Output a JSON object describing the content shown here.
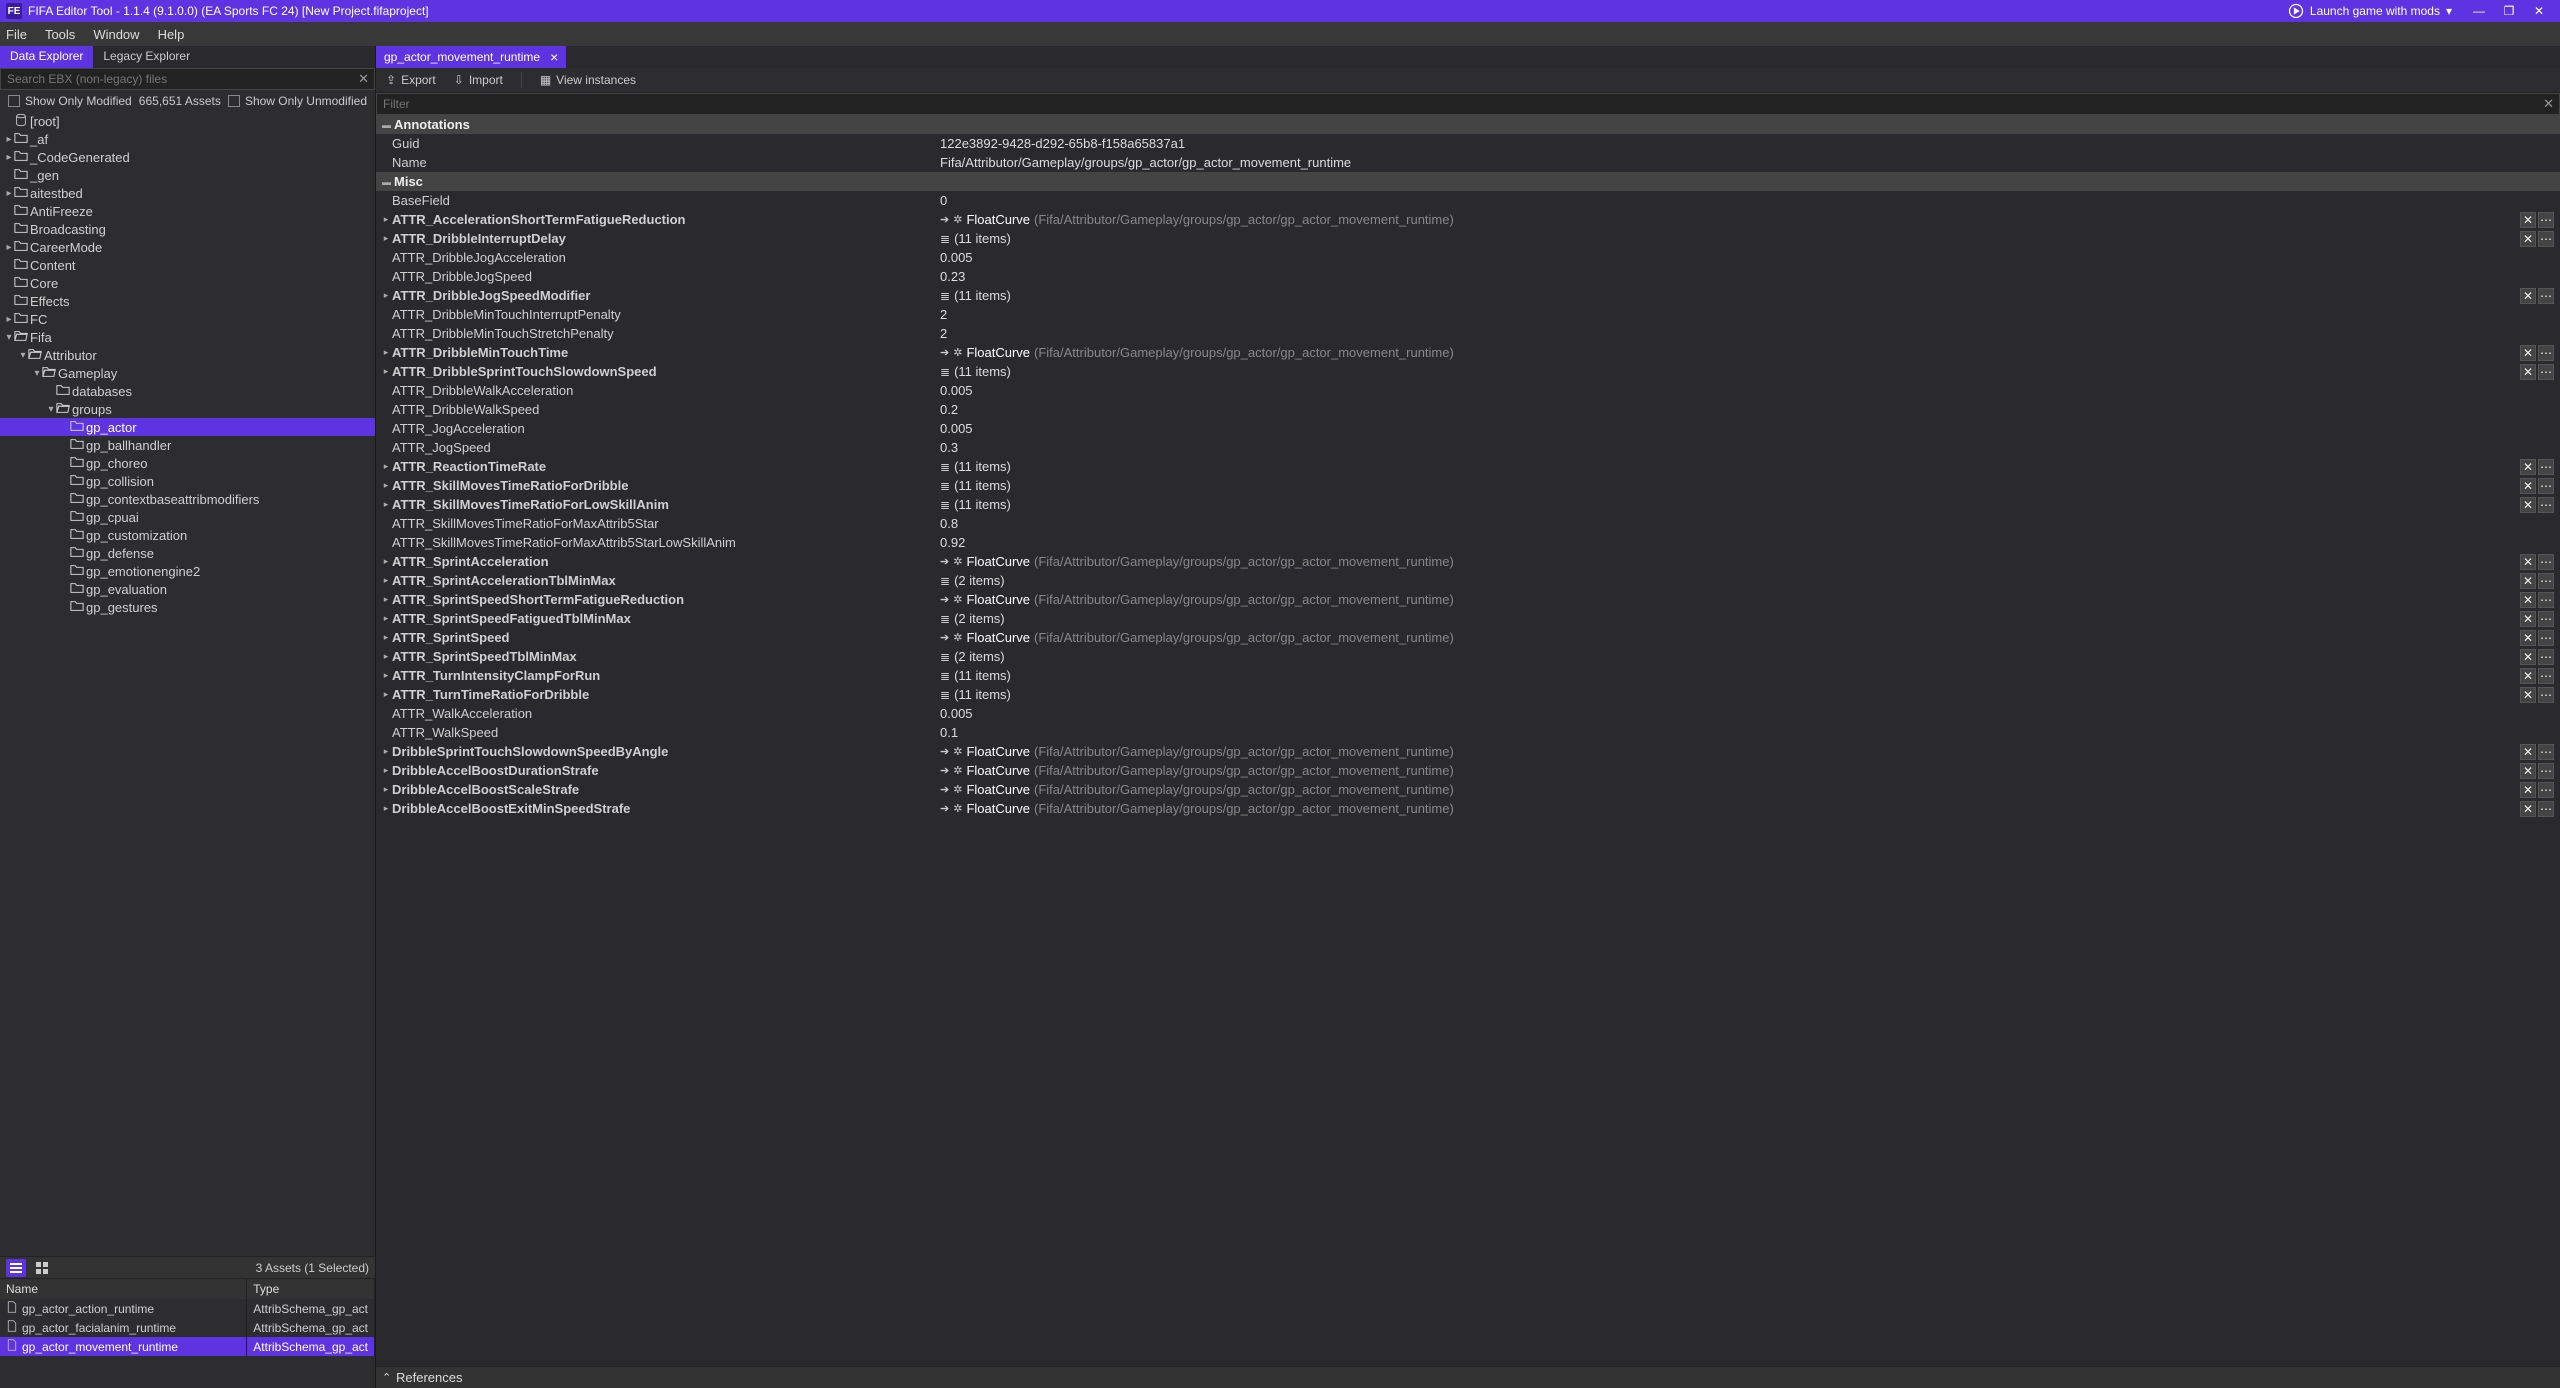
{
  "window": {
    "title": "FIFA Editor Tool - 1.1.4 (9.1.0.0) (EA Sports FC 24) [New Project.fifaproject]",
    "launch": "Launch game with mods"
  },
  "menu": [
    "File",
    "Tools",
    "Window",
    "Help"
  ],
  "left": {
    "tabs": [
      "Data Explorer",
      "Legacy Explorer"
    ],
    "search_ph": "Search EBX (non-legacy) files",
    "show_modified": "Show Only Modified",
    "asset_count": "665,651 Assets",
    "show_unmodified": "Show Only Unmodified",
    "tree": [
      {
        "d": 0,
        "ic": "db",
        "t": "[root]",
        "c": 0
      },
      {
        "d": 0,
        "ic": "f",
        "t": "_af",
        "c": 1
      },
      {
        "d": 0,
        "ic": "f",
        "t": "_CodeGenerated",
        "c": 1
      },
      {
        "d": 0,
        "ic": "f",
        "t": "_gen",
        "c": 0
      },
      {
        "d": 0,
        "ic": "f",
        "t": "aitestbed",
        "c": 1
      },
      {
        "d": 0,
        "ic": "f",
        "t": "AntiFreeze",
        "c": 0
      },
      {
        "d": 0,
        "ic": "f",
        "t": "Broadcasting",
        "c": 0
      },
      {
        "d": 0,
        "ic": "f",
        "t": "CareerMode",
        "c": 1
      },
      {
        "d": 0,
        "ic": "f",
        "t": "Content",
        "c": 0
      },
      {
        "d": 0,
        "ic": "f",
        "t": "Core",
        "c": 0
      },
      {
        "d": 0,
        "ic": "f",
        "t": "Effects",
        "c": 0
      },
      {
        "d": 0,
        "ic": "f",
        "t": "FC",
        "c": 1
      },
      {
        "d": 0,
        "ic": "fo",
        "t": "Fifa",
        "c": 2
      },
      {
        "d": 1,
        "ic": "fo",
        "t": "Attributor",
        "c": 2
      },
      {
        "d": 2,
        "ic": "fo",
        "t": "Gameplay",
        "c": 2
      },
      {
        "d": 3,
        "ic": "f",
        "t": "databases",
        "c": 0
      },
      {
        "d": 3,
        "ic": "fo",
        "t": "groups",
        "c": 2
      },
      {
        "d": 4,
        "ic": "f",
        "t": "gp_actor",
        "c": 0,
        "sel": true
      },
      {
        "d": 4,
        "ic": "f",
        "t": "gp_ballhandler",
        "c": 0
      },
      {
        "d": 4,
        "ic": "f",
        "t": "gp_choreo",
        "c": 0
      },
      {
        "d": 4,
        "ic": "f",
        "t": "gp_collision",
        "c": 0
      },
      {
        "d": 4,
        "ic": "f",
        "t": "gp_contextbaseattribmodifiers",
        "c": 0
      },
      {
        "d": 4,
        "ic": "f",
        "t": "gp_cpuai",
        "c": 0
      },
      {
        "d": 4,
        "ic": "f",
        "t": "gp_customization",
        "c": 0
      },
      {
        "d": 4,
        "ic": "f",
        "t": "gp_defense",
        "c": 0
      },
      {
        "d": 4,
        "ic": "f",
        "t": "gp_emotionengine2",
        "c": 0
      },
      {
        "d": 4,
        "ic": "f",
        "t": "gp_evaluation",
        "c": 0
      },
      {
        "d": 4,
        "ic": "f",
        "t": "gp_gestures",
        "c": 0
      }
    ],
    "assets_info": "3 Assets (1 Selected)",
    "grid_head": [
      "Name",
      "Type"
    ],
    "grid": [
      {
        "n": "gp_actor_action_runtime",
        "t": "AttribSchema_gp_act"
      },
      {
        "n": "gp_actor_facialanim_runtime",
        "t": "AttribSchema_gp_act"
      },
      {
        "n": "gp_actor_movement_runtime",
        "t": "AttribSchema_gp_act",
        "sel": true
      }
    ]
  },
  "right": {
    "tab": "gp_actor_movement_runtime",
    "toolbar": {
      "export": "Export",
      "import": "Import",
      "view": "View instances"
    },
    "filter_ph": "Filter",
    "sections": {
      "annot": "Annotations",
      "misc": "Misc",
      "refs": "References"
    },
    "annot": [
      {
        "k": "Guid",
        "v": "122e3892-9428-d292-65b8-f158a65837a1"
      },
      {
        "k": "Name",
        "v": "Fifa/Attributor/Gameplay/groups/gp_actor/gp_actor_movement_runtime"
      }
    ],
    "misc": [
      {
        "k": "BaseField",
        "v": "0",
        "e": 0
      },
      {
        "k": "ATTR_AccelerationShortTermFatigueReduction",
        "vt": "fc",
        "e": 1,
        "b": 1
      },
      {
        "k": "ATTR_DribbleInterruptDelay",
        "vt": "li",
        "v": "(11 items)",
        "e": 1,
        "b": 1
      },
      {
        "k": "ATTR_DribbleJogAcceleration",
        "v": "0.005",
        "e": 0
      },
      {
        "k": "ATTR_DribbleJogSpeed",
        "v": "0.23",
        "e": 0
      },
      {
        "k": "ATTR_DribbleJogSpeedModifier",
        "vt": "li",
        "v": "(11 items)",
        "e": 1,
        "b": 1
      },
      {
        "k": "ATTR_DribbleMinTouchInterruptPenalty",
        "v": "2",
        "e": 0
      },
      {
        "k": "ATTR_DribbleMinTouchStretchPenalty",
        "v": "2",
        "e": 0
      },
      {
        "k": "ATTR_DribbleMinTouchTime",
        "vt": "fc",
        "e": 1,
        "b": 1
      },
      {
        "k": "ATTR_DribbleSprintTouchSlowdownSpeed",
        "vt": "li",
        "v": "(11 items)",
        "e": 1,
        "b": 1
      },
      {
        "k": "ATTR_DribbleWalkAcceleration",
        "v": "0.005",
        "e": 0
      },
      {
        "k": "ATTR_DribbleWalkSpeed",
        "v": "0.2",
        "e": 0
      },
      {
        "k": "ATTR_JogAcceleration",
        "v": "0.005",
        "e": 0
      },
      {
        "k": "ATTR_JogSpeed",
        "v": "0.3",
        "e": 0
      },
      {
        "k": "ATTR_ReactionTimeRate",
        "vt": "li",
        "v": "(11 items)",
        "e": 1,
        "b": 1
      },
      {
        "k": "ATTR_SkillMovesTimeRatioForDribble",
        "vt": "li",
        "v": "(11 items)",
        "e": 1,
        "b": 1
      },
      {
        "k": "ATTR_SkillMovesTimeRatioForLowSkillAnim",
        "vt": "li",
        "v": "(11 items)",
        "e": 1,
        "b": 1
      },
      {
        "k": "ATTR_SkillMovesTimeRatioForMaxAttrib5Star",
        "v": "0.8",
        "e": 0
      },
      {
        "k": "ATTR_SkillMovesTimeRatioForMaxAttrib5StarLowSkillAnim",
        "v": "0.92",
        "e": 0
      },
      {
        "k": "ATTR_SprintAcceleration",
        "vt": "fc",
        "e": 1,
        "b": 1
      },
      {
        "k": "ATTR_SprintAccelerationTblMinMax",
        "vt": "li",
        "v": "(2 items)",
        "e": 1,
        "b": 1
      },
      {
        "k": "ATTR_SprintSpeedShortTermFatigueReduction",
        "vt": "fc",
        "e": 1,
        "b": 1
      },
      {
        "k": "ATTR_SprintSpeedFatiguedTblMinMax",
        "vt": "li",
        "v": "(2 items)",
        "e": 1,
        "b": 1
      },
      {
        "k": "ATTR_SprintSpeed",
        "vt": "fc",
        "e": 1,
        "b": 1
      },
      {
        "k": "ATTR_SprintSpeedTblMinMax",
        "vt": "li",
        "v": "(2 items)",
        "e": 1,
        "b": 1
      },
      {
        "k": "ATTR_TurnIntensityClampForRun",
        "vt": "li",
        "v": "(11 items)",
        "e": 1,
        "b": 1
      },
      {
        "k": "ATTR_TurnTimeRatioForDribble",
        "vt": "li",
        "v": "(11 items)",
        "e": 1,
        "b": 1
      },
      {
        "k": "ATTR_WalkAcceleration",
        "v": "0.005",
        "e": 0
      },
      {
        "k": "ATTR_WalkSpeed",
        "v": "0.1",
        "e": 0
      },
      {
        "k": "DribbleSprintTouchSlowdownSpeedByAngle",
        "vt": "fc",
        "e": 1,
        "b": 1
      },
      {
        "k": "DribbleAccelBoostDurationStrafe",
        "vt": "fc",
        "e": 1,
        "b": 1
      },
      {
        "k": "DribbleAccelBoostScaleStrafe",
        "vt": "fc",
        "e": 1,
        "b": 1
      },
      {
        "k": "DribbleAccelBoostExitMinSpeedStrafe",
        "vt": "fc",
        "e": 1,
        "b": 1
      }
    ],
    "fc_label": "FloatCurve",
    "fc_path": "(Fifa/Attributor/Gameplay/groups/gp_actor/gp_actor_movement_runtime)"
  }
}
